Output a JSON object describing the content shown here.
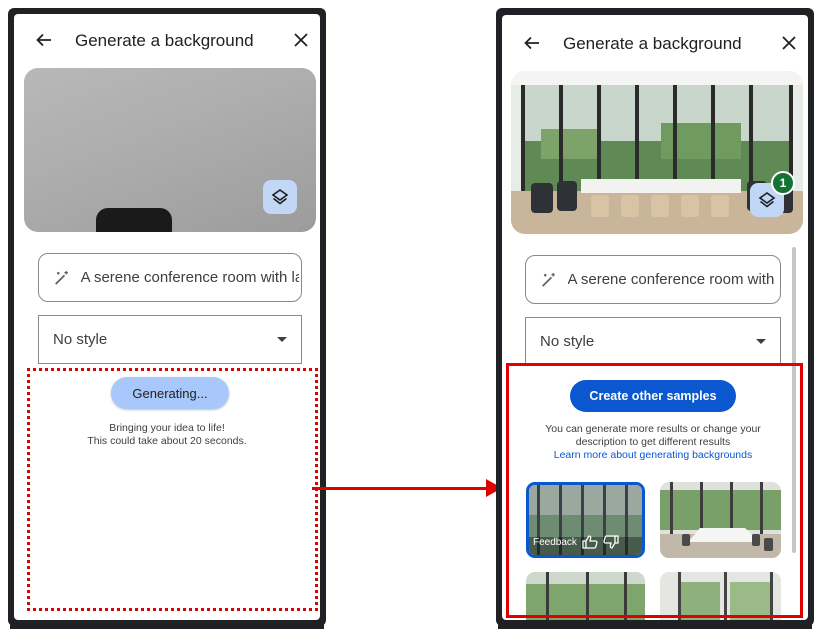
{
  "left_panel": {
    "title": "Generate a background",
    "prompt_value": "A serene conference room with la",
    "style_value": "No style",
    "generating_label": "Generating...",
    "generating_note_line1": "Bringing your idea to life!",
    "generating_note_line2": "This could take about 20 seconds."
  },
  "right_panel": {
    "title": "Generate a background",
    "prompt_value": "A serene conference room with l",
    "style_value": "No style",
    "layers_badge": "1",
    "create_button": "Create other samples",
    "info_line1": "You can generate more results or change your",
    "info_line2": "description to get different results",
    "learn_more_link": "Learn more about generating backgrounds",
    "feedback_label": "Feedback"
  },
  "icons": [
    "back-arrow-icon",
    "close-icon",
    "layers-icon",
    "magic-wand-icon",
    "dropdown-caret-icon",
    "thumbs-up-icon",
    "thumbs-down-icon",
    "arrow-connector"
  ],
  "colors": {
    "accent_blue": "#0b57d0",
    "generating_blue": "#a8c7fa",
    "annotation_red": "#e00000",
    "badge_green": "#137333"
  }
}
